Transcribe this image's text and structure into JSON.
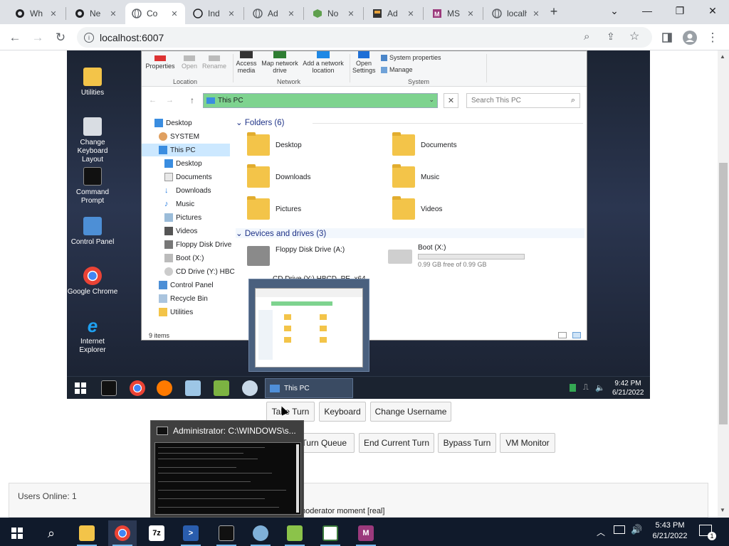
{
  "browser": {
    "tabs": [
      {
        "title": "Wh",
        "icon": "github-icon"
      },
      {
        "title": "Ne",
        "icon": "github-icon"
      },
      {
        "title": "Co",
        "icon": "globe-icon",
        "active": true
      },
      {
        "title": "Ind",
        "icon": "octocat-icon"
      },
      {
        "title": "Ad",
        "icon": "globe-icon"
      },
      {
        "title": "No",
        "icon": "node-icon"
      },
      {
        "title": "Ad",
        "icon": "hfs-icon"
      },
      {
        "title": "MS",
        "icon": "msys-icon"
      },
      {
        "title": "localho",
        "icon": "globe-icon"
      }
    ],
    "new_tab": "+",
    "url": "localhost:6007"
  },
  "vm": {
    "desktop_icons": [
      "Utilities",
      "Change Keyboard Layout",
      "Command Prompt",
      "Control Panel",
      "Google Chrome",
      "Internet Explorer"
    ],
    "explorer": {
      "ribbon": {
        "properties": "Properties",
        "open": "Open",
        "rename": "Rename",
        "access_media": "Access media",
        "map_network_drive": "Map network drive",
        "add_network_location": "Add a network location",
        "open_settings": "Open Settings",
        "system_properties": "System properties",
        "manage": "Manage",
        "group_location": "Location",
        "group_network": "Network",
        "group_system": "System"
      },
      "address": "This PC",
      "search_placeholder": "Search This PC",
      "nav": [
        "Desktop",
        "SYSTEM",
        "This PC",
        "Desktop",
        "Documents",
        "Downloads",
        "Music",
        "Pictures",
        "Videos",
        "Floppy Disk Drive",
        "Boot (X:)",
        "CD Drive (Y:) HBC",
        "Control Panel",
        "Recycle Bin",
        "Utilities"
      ],
      "folders_header": "Folders (6)",
      "folders": [
        "Desktop",
        "Documents",
        "Downloads",
        "Music",
        "Pictures",
        "Videos"
      ],
      "devices_header": "Devices and drives (3)",
      "floppy": "Floppy Disk Drive (A:)",
      "boot": "Boot (X:)",
      "boot_free": "0.99 GB free of 0.99 GB",
      "boot_used_fraction": 0.0,
      "cd_partial": "CD Drive (Y:) HBCD_PE_x64",
      "status": "9 items"
    },
    "taskbar": {
      "active_window": "This PC",
      "time": "9:42 PM",
      "date": "6/21/2022"
    }
  },
  "controls": {
    "take_turn": "Take Turn",
    "keyboard": "Keyboard",
    "change_username": "Change Username",
    "end_turn_queue": "r Turn Queue",
    "end_current_turn": "End Current Turn",
    "bypass_turn": "Bypass Turn",
    "vm_monitor": "VM Monitor"
  },
  "chat": {
    "users_online": "Users Online: 1",
    "message": "moderator moment [real]"
  },
  "cmd_preview": {
    "title": "Administrator: C:\\WINDOWS\\s..."
  },
  "windows_taskbar": {
    "time": "5:43 PM",
    "date": "6/21/2022",
    "notifications": "1",
    "apps": [
      "start-icon",
      "search-icon",
      "file-explorer-icon",
      "chrome-icon",
      "7zip-icon",
      "powershell-icon",
      "cmd-icon",
      "network-app-icon",
      "notepadpp-icon",
      "spreadsheet-icon",
      "msys-icon"
    ]
  }
}
